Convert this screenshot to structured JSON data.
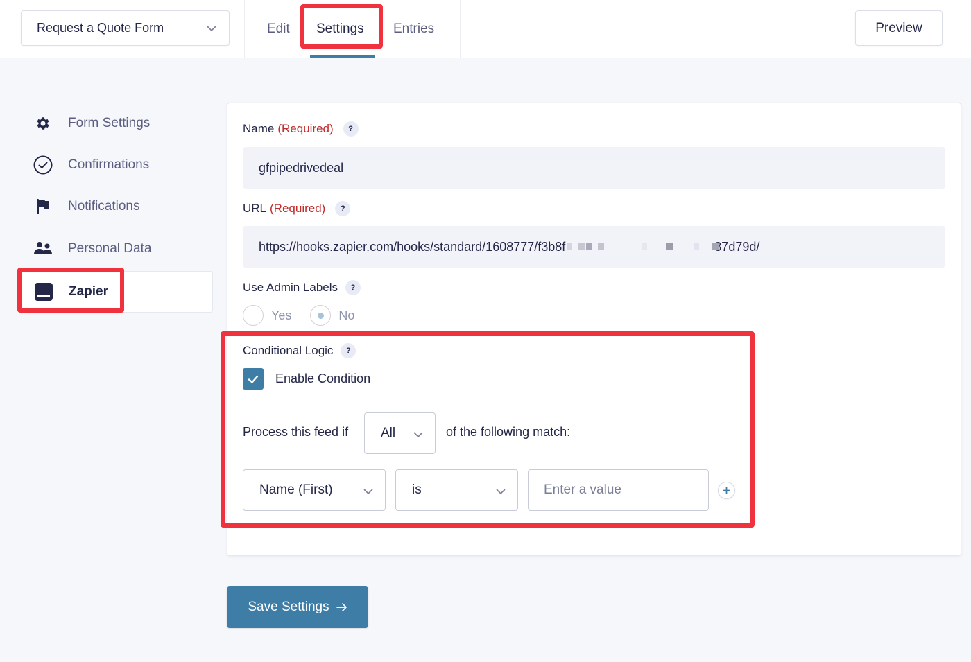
{
  "header": {
    "form_selector": {
      "value": "Request a Quote Form"
    },
    "tabs": [
      {
        "label": "Edit",
        "active": false
      },
      {
        "label": "Settings",
        "active": true
      },
      {
        "label": "Entries",
        "active": false
      }
    ],
    "preview_label": "Preview"
  },
  "sidebar": {
    "items": [
      {
        "label": "Form Settings",
        "icon": "gear-icon",
        "active": false
      },
      {
        "label": "Confirmations",
        "icon": "check-circle-icon",
        "active": false
      },
      {
        "label": "Notifications",
        "icon": "flag-icon",
        "active": false
      },
      {
        "label": "Personal Data",
        "icon": "users-icon",
        "active": false
      },
      {
        "label": "Zapier",
        "icon": "zapier-icon",
        "active": true
      }
    ]
  },
  "form": {
    "name": {
      "label": "Name",
      "required_label": "(Required)",
      "help": "?",
      "value": "gfpipedrivedeal"
    },
    "url": {
      "label": "URL",
      "required_label": "(Required)",
      "help": "?",
      "value_visible_prefix": "https://hooks.zapier.com/hooks/standard/1608777/f3b8f",
      "value_visible_suffix": "87d79d/",
      "redacted": true
    },
    "admin_labels": {
      "label": "Use Admin Labels",
      "help": "?",
      "options": [
        {
          "label": "Yes",
          "selected": false
        },
        {
          "label": "No",
          "selected": true
        }
      ]
    },
    "conditional_logic": {
      "label": "Conditional Logic",
      "help": "?",
      "enable_label": "Enable Condition",
      "enabled": true,
      "process_prefix": "Process this feed if",
      "match_type": "All",
      "process_suffix": "of the following match:",
      "rule": {
        "field": "Name (First)",
        "operator": "is",
        "value_placeholder": "Enter a value",
        "value": ""
      },
      "add_rule": "+"
    }
  },
  "save_button": {
    "label": "Save Settings",
    "icon": "arrow-right-icon"
  },
  "colors": {
    "accent": "#3e7da6",
    "highlight": "#f0323f",
    "required": "#c02b2b",
    "text": "#242748",
    "muted": "#5b5e80"
  }
}
